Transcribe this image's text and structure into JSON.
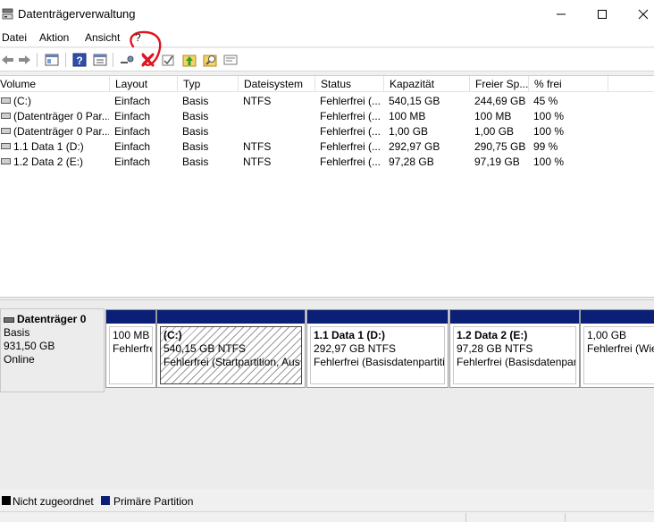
{
  "window": {
    "title": "Datenträgerverwaltung"
  },
  "menu": [
    "Datei",
    "Aktion",
    "Ansicht",
    "?"
  ],
  "toolbar": [
    "back-arrow-icon",
    "forward-arrow-icon",
    "console-tree-icon",
    "help-icon",
    "properties-icon",
    "connect-icon",
    "delete-icon",
    "check-icon",
    "up-icon",
    "search-icon",
    "list-icon"
  ],
  "annotation": {
    "color": "#e0141e",
    "shape": "red-circle-and-x-over-delete-button"
  },
  "columns": [
    "Volume",
    "Layout",
    "Typ",
    "Dateisystem",
    "Status",
    "Kapazität",
    "Freier Sp...",
    "% frei"
  ],
  "volumes": [
    [
      "(C:)",
      "Einfach",
      "Basis",
      "NTFS",
      "Fehlerfrei (...",
      "540,15 GB",
      "244,69 GB",
      "45 %"
    ],
    [
      "(Datenträger 0 Par...",
      "Einfach",
      "Basis",
      "",
      "Fehlerfrei (...",
      "100 MB",
      "100 MB",
      "100 %"
    ],
    [
      "(Datenträger 0 Par...",
      "Einfach",
      "Basis",
      "",
      "Fehlerfrei (...",
      "1,00 GB",
      "1,00 GB",
      "100 %"
    ],
    [
      "1.1 Data 1 (D:)",
      "Einfach",
      "Basis",
      "NTFS",
      "Fehlerfrei (...",
      "292,97 GB",
      "290,75 GB",
      "99 %"
    ],
    [
      "1.2 Data 2 (E:)",
      "Einfach",
      "Basis",
      "NTFS",
      "Fehlerfrei (...",
      "97,28 GB",
      "97,19 GB",
      "100 %"
    ]
  ],
  "disk": {
    "name": "Datenträger 0",
    "type": "Basis",
    "size": "931,50 GB",
    "state": "Online",
    "partitions": [
      {
        "name": "",
        "size": "100 MB",
        "status": "Fehlerfrei (EFI-Systempartition)"
      },
      {
        "name": "(C:)",
        "size": "540,15 GB NTFS",
        "status": "Fehlerfrei (Startpartition, Aus"
      },
      {
        "name": "1.1 Data 1  (D:)",
        "size": "292,97 GB NTFS",
        "status": "Fehlerfrei (Basisdatenpartiti"
      },
      {
        "name": "1.2 Data 2  (E:)",
        "size": "97,28 GB NTFS",
        "status": "Fehlerfrei (Basisdatenpar"
      },
      {
        "name": "",
        "size": "1,00 GB",
        "status": "Fehlerfrei (Wie"
      }
    ]
  },
  "legend": [
    {
      "label": "Nicht zugeordnet",
      "color": "#000000"
    },
    {
      "label": "Primäre Partition",
      "color": "#0a1f75"
    }
  ]
}
